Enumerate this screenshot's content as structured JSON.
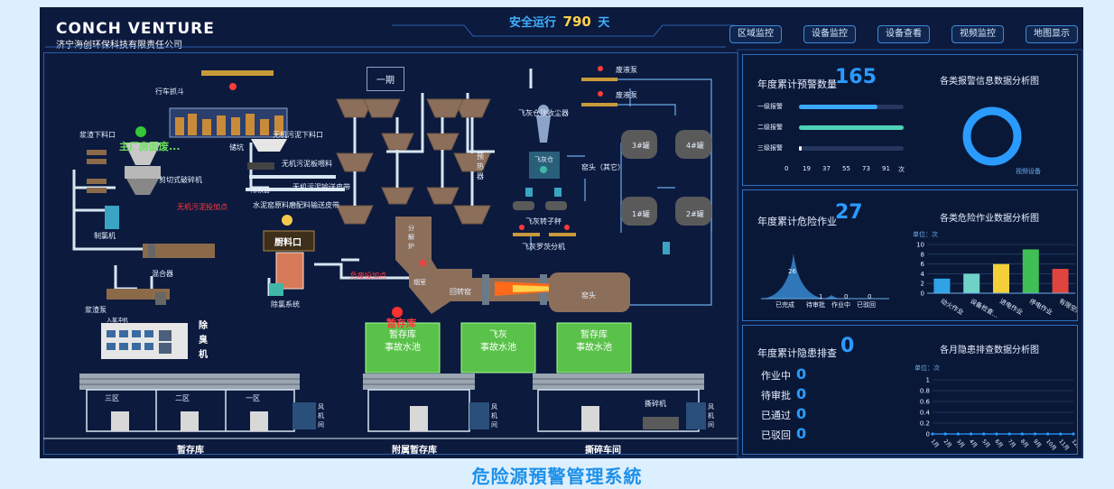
{
  "header": {
    "logo": "CONCH VENTURE",
    "company": "济宁海创环保科技有限责任公司",
    "safe_prefix": "安全运行",
    "safe_days": "790",
    "safe_suffix": "天"
  },
  "nav": [
    "区域监控",
    "设备监控",
    "设备查看",
    "视频监控",
    "地图显示"
  ],
  "system_title": "危险源預警管理系統",
  "plant": {
    "phase": "一期",
    "labels": {
      "crane": "行车抓斗",
      "pit": "储坑",
      "slag_outlet": "浆渣下料口",
      "main_plant": "主厂房固废...",
      "shredder": "剪切式破碎机",
      "chlorine_maker": "制氯机",
      "mixer": "混合器",
      "slurry_pump": "浆渣泵",
      "sludge_outlet": "无机污泥下料口",
      "sludge_plate": "无机污泥板喂料",
      "sludge_belt": "无机污泥输送皮带",
      "iron_remover": "除铁器",
      "raw_belt": "水泥窑原料磨配料输送皮带",
      "sludge_feed": "无机污泥投加点",
      "feed_port": "厨料口",
      "dechlorination": "除氯系统",
      "waste_feed": "危废投加点",
      "calciner": "分解炉",
      "smoke_chamber": "烟室",
      "preheater": "预热器",
      "rotary_kiln": "回转窑",
      "kiln_head": "窑头",
      "kiln_head_other": "窑头（其它）",
      "fly_ash_collector": "飞灰仓顶收尘器",
      "fly_ash_bin": "飞灰仓",
      "fly_ash_rotor": "飞灰转子秤",
      "fly_ash_separator": "飞灰罗茨分机",
      "waste_pump_1": "废液泵",
      "waste_pump_2": "废液泵",
      "tank_1": "1#罐",
      "tank_2": "2#罐",
      "tank_3": "3#罐",
      "tank_4": "4#罐",
      "temp_store": "暂存库",
      "deodorizer": "除臭机",
      "fan_room": "风机间",
      "shred_room": "撕碎机",
      "chg": "入氯冲机"
    },
    "pools": [
      {
        "l1": "暂存库",
        "l2": "事故水池"
      },
      {
        "l1": "飞灰",
        "l2": "事故水池"
      },
      {
        "l1": "暂存库",
        "l2": "事故水池"
      }
    ],
    "zones": [
      "三区",
      "二区",
      "一区"
    ],
    "bottom_labels": [
      "暂存库",
      "附属暂存库",
      "撕碎车间"
    ]
  },
  "panel_alarm": {
    "title": "年度累计预警数量",
    "value": "165",
    "chart_title": "各类报警信息数据分析图",
    "levels": [
      {
        "name": "一级报警",
        "value": 75,
        "color": "#3aa8ff"
      },
      {
        "name": "二级报警",
        "value": 100,
        "color": "#4dd2b6"
      },
      {
        "name": "三级报警",
        "value": 3,
        "color": "#ffffff"
      }
    ],
    "axis": [
      "0",
      "19",
      "37",
      "55",
      "73",
      "91",
      "次"
    ],
    "donut_label": "视频设备"
  },
  "panel_work": {
    "title": "年度累计危险作业",
    "value": "27",
    "chart_title": "各类危险作业数据分析图",
    "status": [
      {
        "name": "已完成",
        "value": "26"
      },
      {
        "name": "待审批",
        "value": "1"
      },
      {
        "name": "作业中",
        "value": "0"
      },
      {
        "name": "已驳回",
        "value": "0"
      }
    ],
    "unit": "单位：次"
  },
  "panel_hazard": {
    "title": "年度累计隐患排查",
    "value": "0",
    "chart_title": "各月隐患排查数据分析图",
    "unit": "单位：次",
    "rows": [
      {
        "name": "作业中",
        "value": "0"
      },
      {
        "name": "待审批",
        "value": "0"
      },
      {
        "name": "已通过",
        "value": "0"
      },
      {
        "name": "已驳回",
        "value": "0"
      }
    ]
  },
  "chart_data": [
    {
      "type": "bar",
      "title": "各类危险作业数据分析图",
      "ylabel": "单位：次",
      "ylim": [
        0,
        10
      ],
      "yticks": [
        "0",
        "2",
        "4",
        "6",
        "8",
        "10"
      ],
      "categories": [
        "动火作业",
        "设备检查...",
        "进电作业",
        "停电作业",
        "有限空间"
      ],
      "values": [
        3,
        4,
        6,
        9,
        5
      ],
      "colors": [
        "#2fa3e6",
        "#6fd2c7",
        "#f3d03a",
        "#3fbf55",
        "#e0443e"
      ]
    },
    {
      "type": "line",
      "title": "各月隐患排查数据分析图",
      "ylabel": "单位：次",
      "ylim": [
        0,
        1
      ],
      "yticks": [
        "0",
        "0.2",
        "0.4",
        "0.6",
        "0.8",
        "1"
      ],
      "categories": [
        "1月",
        "2月",
        "3月",
        "4月",
        "5月",
        "6月",
        "7月",
        "8月",
        "9月",
        "10月",
        "11月",
        "12月"
      ],
      "values": [
        0,
        0,
        0,
        0,
        0,
        0,
        0,
        0,
        0,
        0,
        0,
        0
      ]
    }
  ]
}
